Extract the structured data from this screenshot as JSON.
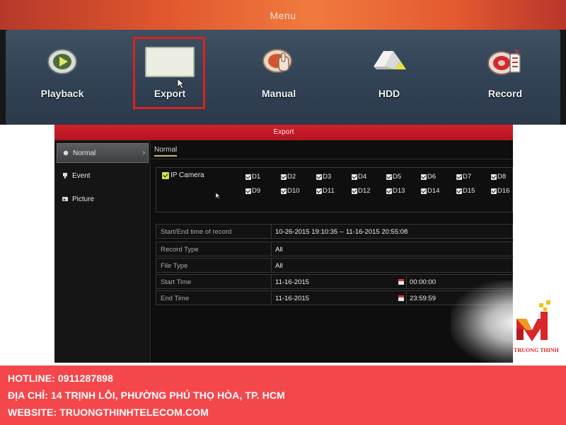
{
  "menu": {
    "title": "Menu",
    "items": [
      {
        "label": "Playback",
        "icon": "playback-icon"
      },
      {
        "label": "Export",
        "icon": "export-icon",
        "selected": true
      },
      {
        "label": "Manual",
        "icon": "manual-icon"
      },
      {
        "label": "HDD",
        "icon": "hdd-icon"
      },
      {
        "label": "Record",
        "icon": "record-icon"
      }
    ]
  },
  "export_window": {
    "title": "Export",
    "sidebar": [
      {
        "label": "Normal",
        "icon": "normal-icon",
        "active": true
      },
      {
        "label": "Event",
        "icon": "event-icon"
      },
      {
        "label": "Picture",
        "icon": "picture-icon"
      }
    ],
    "tab": "Normal",
    "ip_camera_label": "IP Camera",
    "channels": [
      "D1",
      "D2",
      "D3",
      "D4",
      "D5",
      "D6",
      "D7",
      "D8",
      "D9",
      "D10",
      "D11",
      "D12",
      "D13",
      "D14",
      "D15",
      "D16"
    ],
    "fields": {
      "record_time": {
        "label": "Start/End time of record",
        "value": "10-26-2015 19:10:35 -- 11-16-2015 20:55:08"
      },
      "record_type": {
        "label": "Record Type",
        "value": "All"
      },
      "file_type": {
        "label": "File Type",
        "value": "All"
      },
      "start_time": {
        "label": "Start Time",
        "date": "11-16-2015",
        "time": "00:00:00"
      },
      "end_time": {
        "label": "End Time",
        "date": "11-16-2015",
        "time": "23:59:59"
      }
    }
  },
  "brand": {
    "name": "TRUONG THINH",
    "color": "#d8262a"
  },
  "footer": {
    "hotline": "HOTLINE: 0911287898",
    "address": "ĐỊA CHỈ: 14 TRỊNH LỖI, PHƯỜNG PHÚ THỌ HÒA, TP. HCM",
    "website": "WEBSITE: TRUONGTHINHTELECOM.COM",
    "background": "#f4474c"
  }
}
